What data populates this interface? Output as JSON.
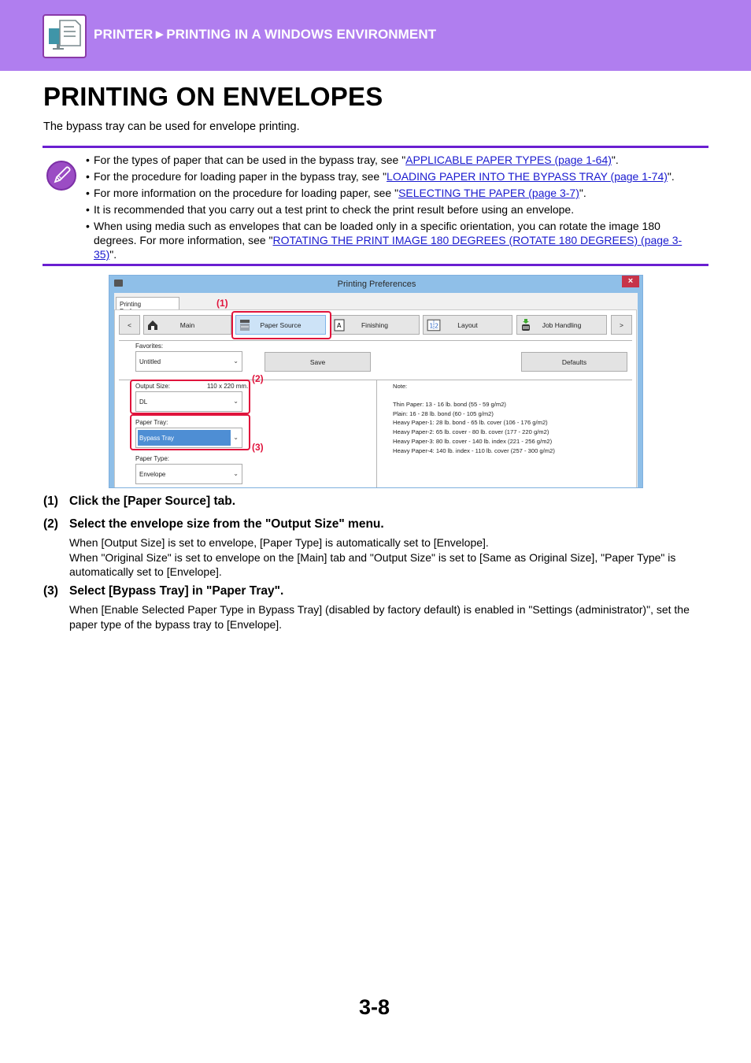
{
  "header": {
    "breadcrumb": "PRINTER►PRINTING IN A WINDOWS ENVIRONMENT",
    "icon": "printer-computer-icon",
    "colors": {
      "band": "#b07eef",
      "rule": "#6a1fd1",
      "link": "#1a1acf",
      "highlight": "#e0143c"
    }
  },
  "page": {
    "title": "PRINTING ON ENVELOPES",
    "intro": "The bypass tray can be used for envelope printing.",
    "page_number": "3-8"
  },
  "note": {
    "icon": "pencil-note-icon",
    "items": [
      {
        "pre": "For the types of paper that can be used in the bypass tray, see \"",
        "link": "APPLICABLE PAPER TYPES (page 1-64)",
        "post": "\"."
      },
      {
        "pre": "For the procedure for loading paper in the bypass tray, see \"",
        "link": "LOADING PAPER INTO THE BYPASS TRAY (page 1-74)",
        "post": "\"."
      },
      {
        "pre": "For more information on the procedure for loading paper, see \"",
        "link": "SELECTING THE PAPER (page 3-7)",
        "post": "\"."
      },
      {
        "pre": "It is recommended that you carry out a test print to check the print result before using an envelope.",
        "link": "",
        "post": ""
      },
      {
        "pre": "When using media such as envelopes that can be loaded only in a specific orientation, you can rotate the image 180 degrees. For more information, see \"",
        "link": "ROTATING THE PRINT IMAGE 180 DEGREES (ROTATE 180 DEGREES) (page 3-35)",
        "post": "\"."
      }
    ]
  },
  "dialog": {
    "title": "Printing Preferences",
    "close": "×",
    "tab": "Printing Preferences",
    "nav": {
      "prev": "<",
      "next": ">",
      "tabs": [
        "Main",
        "Paper Source",
        "Finishing",
        "Layout",
        "Job Handling"
      ],
      "active": "Paper Source"
    },
    "favorites_label": "Favorites:",
    "favorites_value": "Untitled",
    "save_button": "Save",
    "defaults_button": "Defaults",
    "output_size_label": "Output Size:",
    "output_size_dims": "110 x 220 mm.",
    "output_size_value": "DL",
    "paper_tray_label": "Paper Tray:",
    "paper_tray_value": "Bypass Tray",
    "paper_type_label": "Paper Type:",
    "paper_type_value": "Envelope",
    "dropdown_arrow": "⌄",
    "note_title": "Note:",
    "note_lines": [
      "Thin Paper: 13 - 16 lb. bond (55 - 59 g/m2)",
      "Plain: 16 - 28 lb. bond (60 - 105 g/m2)",
      "Heavy Paper-1: 28 lb. bond - 65 lb. cover (106 - 176 g/m2)",
      "Heavy Paper-2: 65 lb. cover - 80 lb. cover (177 - 220 g/m2)",
      "Heavy Paper-3: 80 lb. cover - 140 lb. index (221 - 256 g/m2)",
      "Heavy Paper-4: 140 lb. index - 110 lb. cover (257 - 300 g/m2)"
    ],
    "callouts": [
      "(1)",
      "(2)",
      "(3)"
    ]
  },
  "steps": [
    {
      "num": "(1)",
      "title": "Click the [Paper Source] tab.",
      "desc": ""
    },
    {
      "num": "(2)",
      "title": "Select the envelope size from the \"Output Size\" menu.",
      "desc": "When [Output Size] is set to envelope, [Paper Type] is automatically set to [Envelope].\nWhen \"Original Size\" is set to envelope on the [Main] tab and \"Output Size\" is set to [Same as Original Size], \"Paper Type\" is automatically set to [Envelope]."
    },
    {
      "num": "(3)",
      "title": "Select [Bypass Tray] in \"Paper Tray\".",
      "desc": "When [Enable Selected Paper Type in Bypass Tray] (disabled by factory default) is enabled in \"Settings (administrator)\", set the paper type of the bypass tray to [Envelope]."
    }
  ]
}
